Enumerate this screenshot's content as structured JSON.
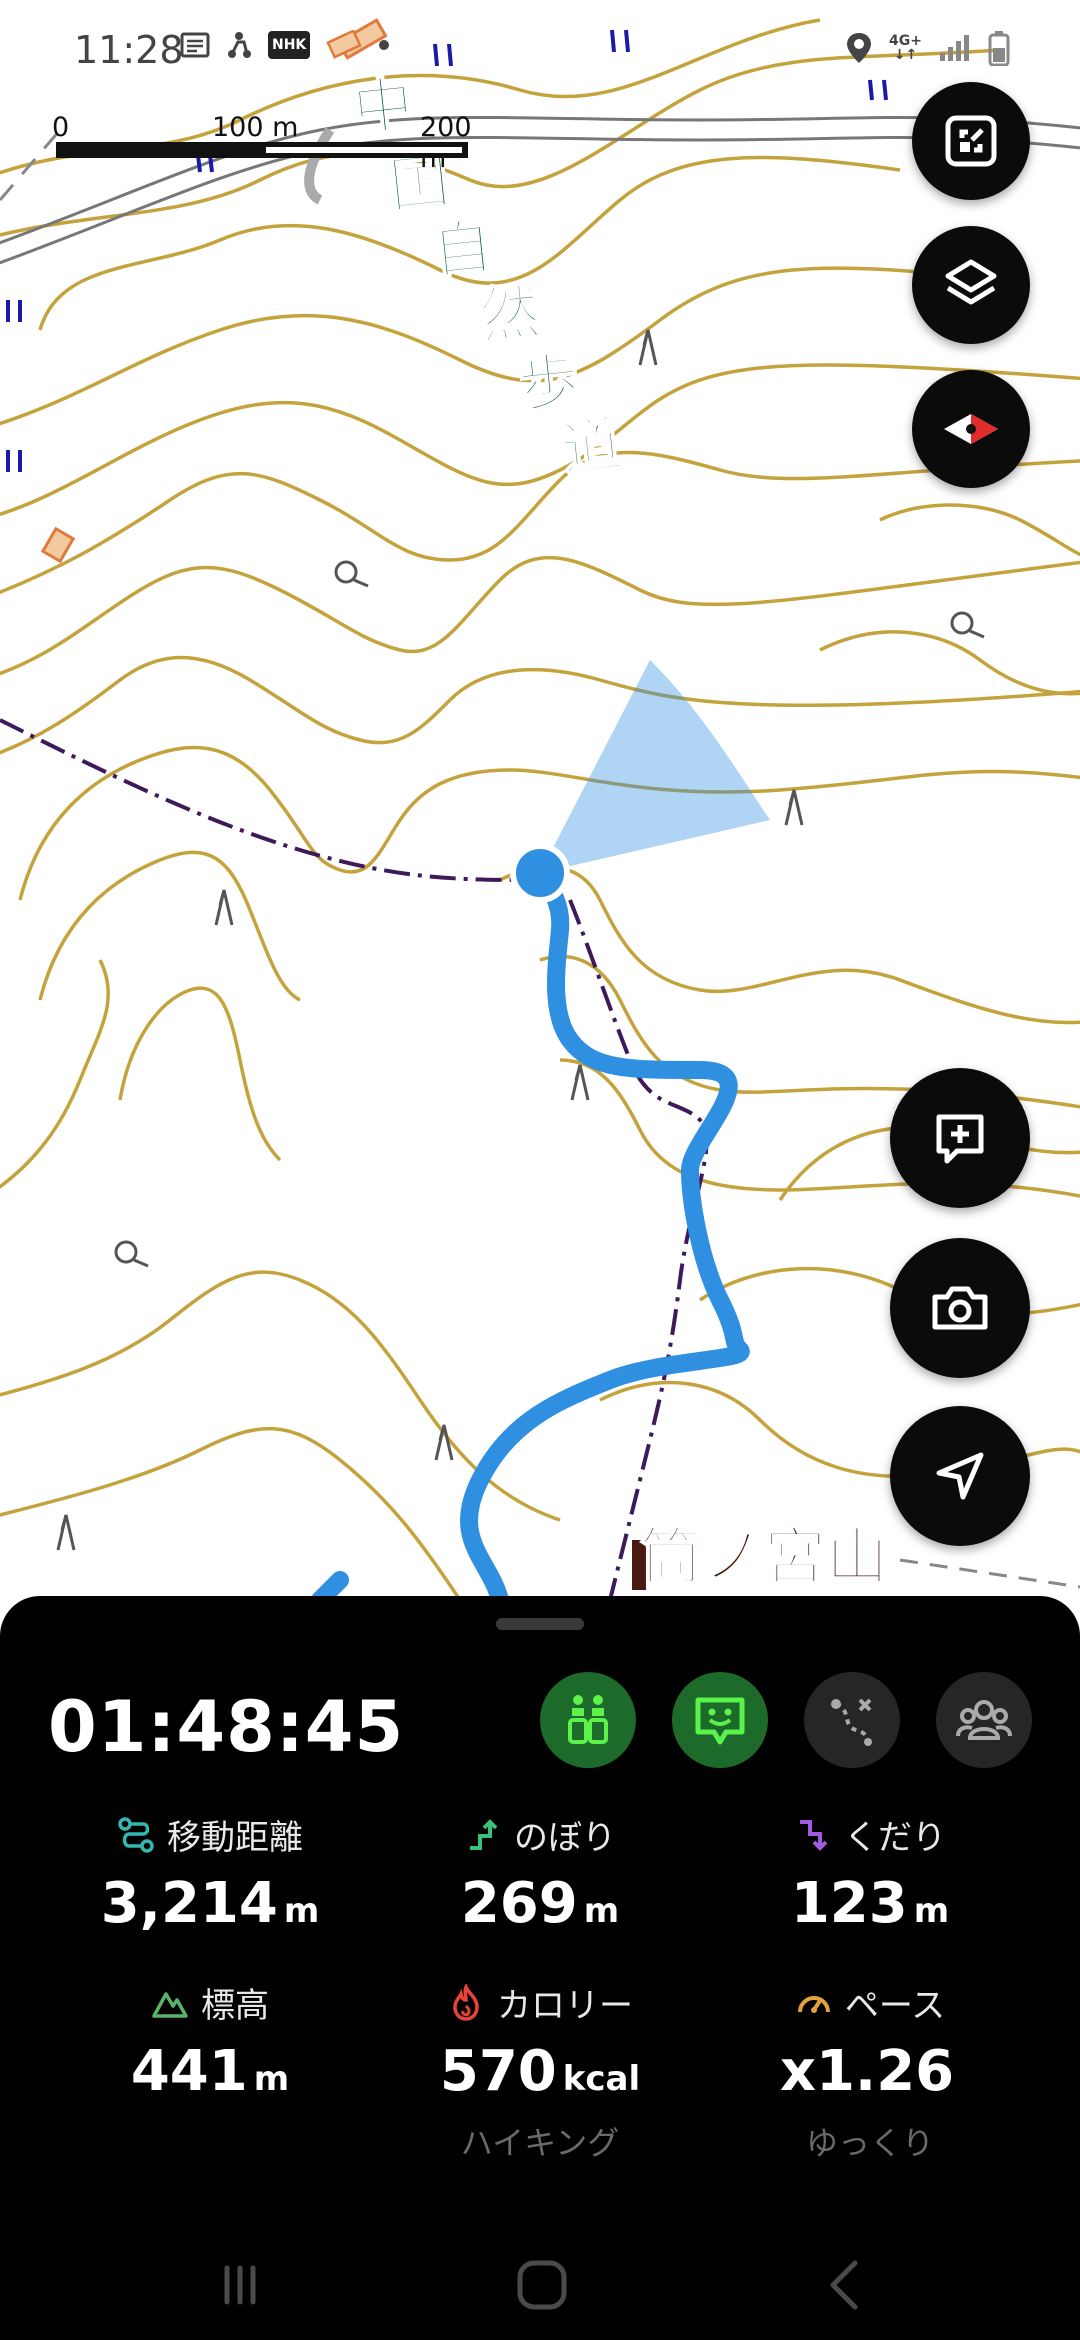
{
  "status_bar": {
    "time": "11:28",
    "network": "4G+",
    "icons_left": [
      "news-icon",
      "scooter-icon",
      "nhk-icon",
      "ticket-icon",
      "dot-icon"
    ],
    "icons_right": [
      "location-pin-icon",
      "network-4g-icon",
      "signal-icon",
      "battery-icon"
    ],
    "nhk_label": "NHK"
  },
  "map": {
    "scale": {
      "label_start": "0",
      "label_mid": "100 m",
      "label_end": "200 m"
    },
    "trail_name": "中国自然歩道",
    "peak_name": "筒ノ宮山",
    "colors": {
      "contour": "#c4a23c",
      "track": "#2f8fe0",
      "trail_text": "#10603a",
      "boundary": "#3e1a5a",
      "peak_text": "#4a1a10"
    }
  },
  "map_controls": {
    "fullscreen_icon": "fullscreen-icon",
    "layers_icon": "layers-icon",
    "compass_icon": "compass-icon",
    "memo_icon": "add-memo-icon",
    "camera_icon": "camera-icon",
    "navigate_icon": "navigation-arrow-icon"
  },
  "activity": {
    "elapsed_time": "01:48:45",
    "mode_buttons": [
      "hiker-stats-icon",
      "smiley-signal-icon",
      "route-icon",
      "group-icon"
    ],
    "stats": [
      {
        "icon": "distance-icon",
        "icon_color": "#32b8b0",
        "label": "移動距離",
        "value": "3,214",
        "unit": "m",
        "sub": ""
      },
      {
        "icon": "ascent-icon",
        "icon_color": "#3bc07a",
        "label": "のぼり",
        "value": "269",
        "unit": "m",
        "sub": ""
      },
      {
        "icon": "descent-icon",
        "icon_color": "#a25be0",
        "label": "くだり",
        "value": "123",
        "unit": "m",
        "sub": ""
      },
      {
        "icon": "elevation-icon",
        "icon_color": "#5ab36a",
        "label": "標高",
        "value": "441",
        "unit": "m",
        "sub": ""
      },
      {
        "icon": "calorie-icon",
        "icon_color": "#e8443a",
        "label": "カロリー",
        "value": "570",
        "unit": "kcal",
        "sub": "ハイキング"
      },
      {
        "icon": "pace-icon",
        "icon_color": "#e0a43a",
        "label": "ペース",
        "value": "x1.26",
        "unit": "",
        "sub": "ゆっくり"
      }
    ]
  },
  "nav_bar": {
    "buttons": [
      "recent-apps-icon",
      "home-icon",
      "back-icon"
    ]
  }
}
